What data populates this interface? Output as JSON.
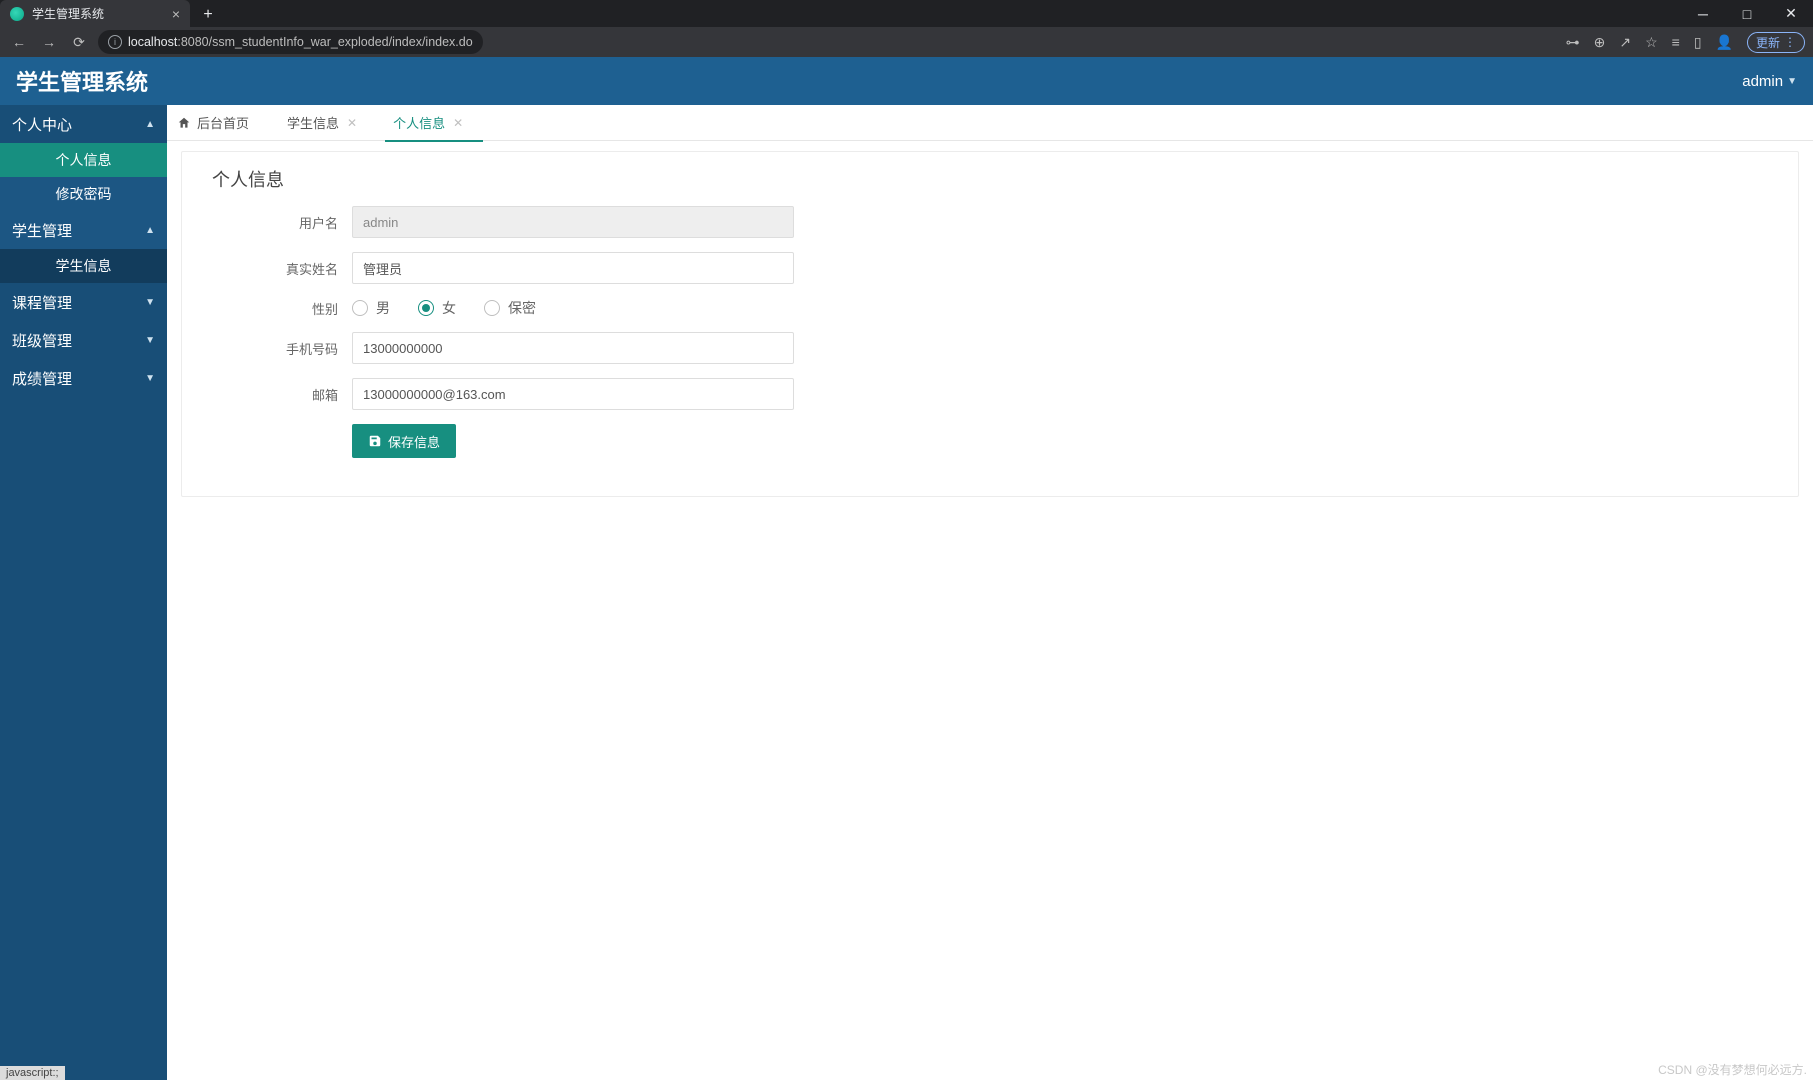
{
  "browser": {
    "tab_title": "学生管理系统",
    "url_host": "localhost",
    "url_rest": ":8080/ssm_studentInfo_war_exploded/index/index.do",
    "update_label": "更新",
    "status_text": "javascript:;"
  },
  "header": {
    "app_title": "学生管理系统",
    "user_name": "admin"
  },
  "sidebar": {
    "groups": [
      {
        "label": "个人中心",
        "expanded": true,
        "items": [
          {
            "label": "个人信息",
            "active": true
          },
          {
            "label": "修改密码",
            "active": false
          }
        ]
      },
      {
        "label": "学生管理",
        "expanded": true,
        "items": [
          {
            "label": "学生信息",
            "active": false
          }
        ]
      },
      {
        "label": "课程管理",
        "expanded": false,
        "items": []
      },
      {
        "label": "班级管理",
        "expanded": false,
        "items": []
      },
      {
        "label": "成绩管理",
        "expanded": false,
        "items": []
      }
    ]
  },
  "tabs": {
    "home_label": "后台首页",
    "items": [
      {
        "label": "学生信息",
        "active": false
      },
      {
        "label": "个人信息",
        "active": true
      }
    ]
  },
  "panel": {
    "title": "个人信息",
    "fields": {
      "username_label": "用户名",
      "username_value": "admin",
      "realname_label": "真实姓名",
      "realname_value": "管理员",
      "gender_label": "性别",
      "gender_options": {
        "male": "男",
        "female": "女",
        "secret": "保密"
      },
      "gender_value": "female",
      "phone_label": "手机号码",
      "phone_value": "13000000000",
      "email_label": "邮箱",
      "email_value": "13000000000@163.com"
    },
    "save_label": "保存信息"
  },
  "watermark": "CSDN @没有梦想何必远方."
}
